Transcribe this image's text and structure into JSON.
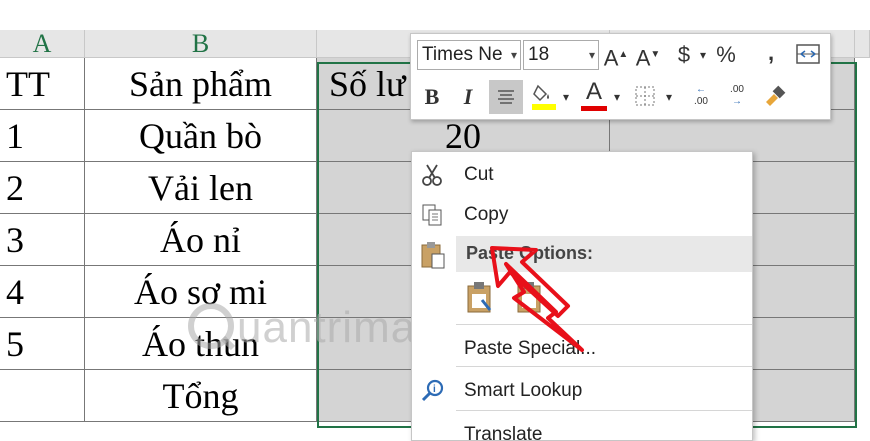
{
  "columns": [
    "A",
    "B"
  ],
  "rows": [
    [
      "TT",
      "Sản phẩm",
      "Số lư"
    ],
    [
      "1",
      "Quần bò",
      "20"
    ],
    [
      "2",
      "Vải len",
      ""
    ],
    [
      "3",
      "Áo nỉ",
      ""
    ],
    [
      "4",
      "Áo sơ mi",
      ""
    ],
    [
      "5",
      "Áo thun",
      ""
    ],
    [
      "",
      "Tổng",
      ""
    ]
  ],
  "mini_toolbar": {
    "font_name": "Times Ne",
    "font_size": "18",
    "grow_font": "A",
    "shrink_font": "A",
    "currency": "$",
    "percent": "%",
    "comma": ",",
    "bold": "B",
    "italic": "I",
    "font_color": "A",
    "increase_decimal": ".00",
    "decrease_decimal": ".00"
  },
  "context_menu": {
    "cut": "Cut",
    "copy": "Copy",
    "paste_options": "Paste Options:",
    "paste_special": "Paste Special...",
    "smart_lookup": "Smart Lookup",
    "translate": "Translate"
  },
  "watermark": "uantrimang",
  "colors": {
    "accent_green": "#217346",
    "selection_gray": "#d4d4d4",
    "highlight_yellow": "#ffff00",
    "font_red": "#e00000",
    "annotation_red": "#e8101a"
  }
}
